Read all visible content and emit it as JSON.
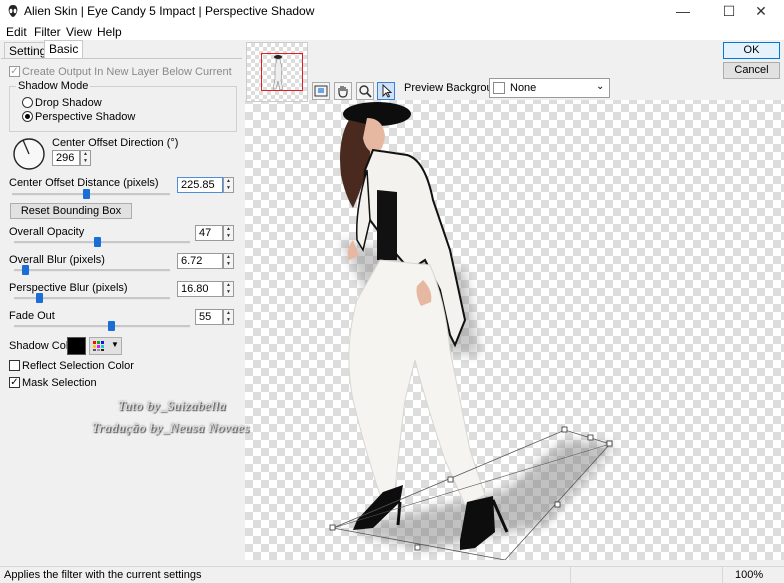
{
  "window": {
    "title": "Alien Skin | Eye Candy 5 Impact | Perspective Shadow",
    "minimize_symbol": "—",
    "maximize_symbol": "☐",
    "close_symbol": "✕"
  },
  "menu": [
    "Edit",
    "Filter",
    "View",
    "Help"
  ],
  "tabs": [
    {
      "label": "Settings",
      "active": false
    },
    {
      "label": "Basic",
      "active": true
    }
  ],
  "basic": {
    "create_output_label": "Create Output In New Layer Below Current",
    "create_output_checked": true,
    "shadow_mode_title": "Shadow Mode",
    "mode_drop": "Drop Shadow",
    "mode_perspective": "Perspective Shadow",
    "selected_mode": "Perspective Shadow",
    "direction_label": "Center Offset Direction (°)",
    "direction_value": "296",
    "distance_label": "Center Offset Distance (pixels)",
    "distance_value": "225.85",
    "distance_slider": 0.47,
    "reset_button": "Reset Bounding Box",
    "opacity_label": "Overall Opacity",
    "opacity_value": "47",
    "opacity_slider": 0.47,
    "blur_label": "Overall Blur (pixels)",
    "blur_value": "6.72",
    "blur_slider": 0.07,
    "persp_blur_label": "Perspective Blur (pixels)",
    "persp_blur_value": "16.80",
    "persp_blur_slider": 0.16,
    "fade_label": "Fade Out",
    "fade_value": "55",
    "fade_slider": 0.55,
    "shadow_color_label": "Shadow Color",
    "shadow_color": "#000000",
    "reflect_label": "Reflect Selection Color",
    "reflect_checked": false,
    "mask_label": "Mask Selection",
    "mask_checked": true
  },
  "preview": {
    "background_label": "Preview Background:",
    "background_value": "None",
    "tools": [
      "navigate-icon",
      "hand-icon",
      "zoom-icon",
      "pointer-icon"
    ]
  },
  "buttons": {
    "ok": "OK",
    "cancel": "Cancel"
  },
  "watermark": {
    "line1": "Tuto by_Suizabella",
    "line2": "Tradução by_Neusa Novaes"
  },
  "status": {
    "message": "Applies the filter with the current settings",
    "zoom": "100%"
  },
  "colors": {
    "accent": "#1a6fd6",
    "ok_border": "#0078d7"
  }
}
